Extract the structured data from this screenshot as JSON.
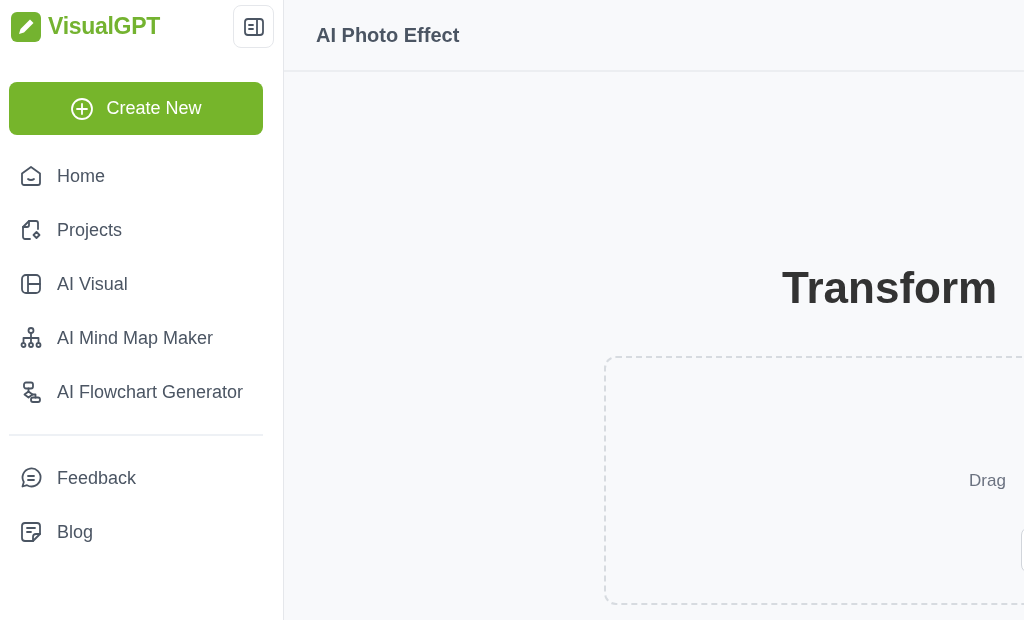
{
  "sidebar": {
    "logo": {
      "text": "VisualGPT"
    },
    "create_button": {
      "label": "Create New"
    },
    "nav_items": [
      {
        "label": "Home"
      },
      {
        "label": "Projects"
      },
      {
        "label": "AI Visual"
      },
      {
        "label": "AI Mind Map Maker"
      },
      {
        "label": "AI Flowchart Generator"
      }
    ],
    "footer_items": [
      {
        "label": "Feedback"
      },
      {
        "label": "Blog"
      }
    ]
  },
  "header": {
    "title": "AI Photo Effect"
  },
  "main": {
    "heading": "Transform",
    "dropzone": {
      "hint": "Drag"
    }
  }
}
